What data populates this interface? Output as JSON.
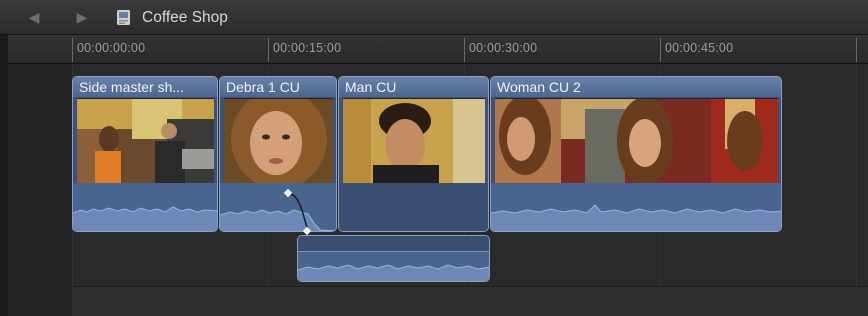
{
  "window": {
    "title": "Coffee Shop"
  },
  "nav": {
    "back_icon": "back-arrow-icon",
    "forward_icon": "forward-arrow-icon",
    "project_icon": "project-icon"
  },
  "ruler": {
    "labels": [
      "00:00:00:00",
      "00:00:15:00",
      "00:00:30:00",
      "00:00:45:00"
    ]
  },
  "clips": [
    {
      "name": "Side master sh..."
    },
    {
      "name": "Debra 1 CU"
    },
    {
      "name": "Man CU"
    },
    {
      "name": "Woman CU 2"
    }
  ],
  "connected_audio": {
    "type": "audio-only clip"
  },
  "colors": {
    "clip_fill": "#3e5274",
    "clip_header": "#5b74a0",
    "background": "#2a2a2c"
  }
}
